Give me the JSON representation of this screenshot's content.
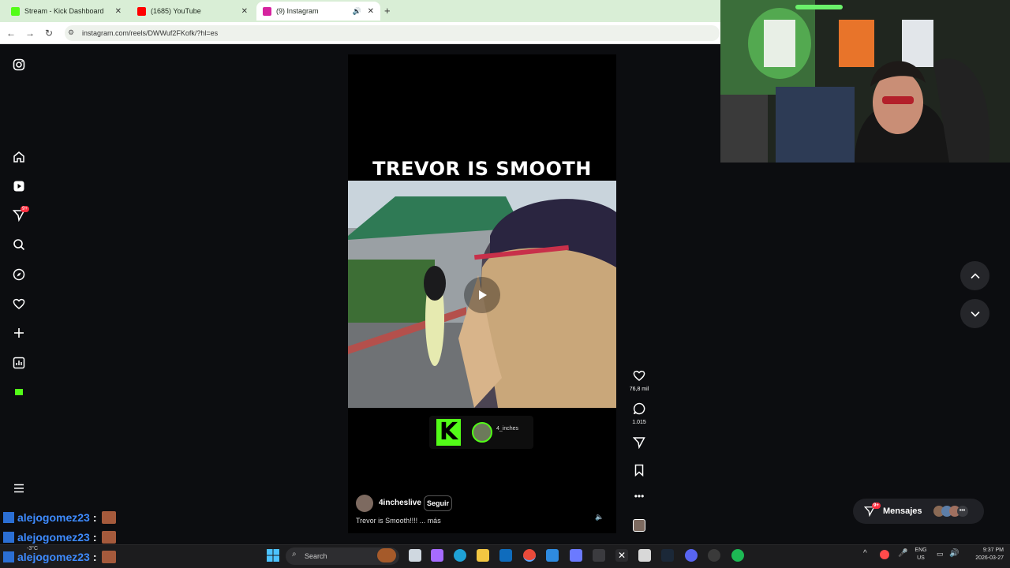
{
  "browser": {
    "tabs": [
      {
        "title": "Stream - Kick Dashboard",
        "favicon_color": "#53fc18"
      },
      {
        "title": "(1685) YouTube",
        "favicon_color": "#ff0000"
      },
      {
        "title": "(9) Instagram",
        "favicon_color": "#d6249f"
      }
    ],
    "url": "instagram.com/reels/DWWuf2FKofk/?hl=es"
  },
  "sidebar": {
    "notifications_badge": "9+"
  },
  "reel": {
    "overlay_title": "TREVOR IS SMOOTH",
    "kick_username": "4_inches",
    "author": "4incheslive",
    "follow_label": "Seguir",
    "caption": "Trevor is Smooth!!!! ... más",
    "likes": "76,8 mil",
    "comments": "1.015"
  },
  "messages": {
    "label": "Mensajes",
    "badge": "9+"
  },
  "chat": [
    {
      "user": "alejogomez23"
    },
    {
      "user": "alejogomez23"
    },
    {
      "user": "alejogomez23"
    }
  ],
  "taskbar": {
    "search_placeholder": "Search",
    "lang_line1": "ENG",
    "lang_line2": "US",
    "time": "9:37 PM",
    "date": "2026-03-27",
    "temp": "-3°C"
  },
  "colors": {
    "kick_green": "#53fc18",
    "chat_name": "#3e8bff",
    "badge_red": "#ff3040"
  }
}
